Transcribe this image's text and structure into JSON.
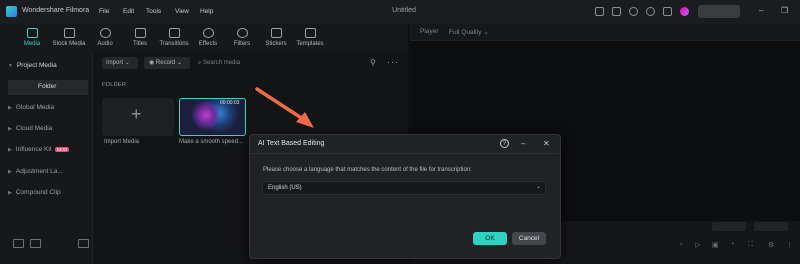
{
  "app": {
    "name": "Wondershare Filmora",
    "document_title": "Untitled"
  },
  "menu": [
    "File",
    "Edit",
    "Tools",
    "View",
    "Help"
  ],
  "media_tools": [
    {
      "label": "Media",
      "active": true
    },
    {
      "label": "Stock Media"
    },
    {
      "label": "Audio"
    },
    {
      "label": "Titles"
    },
    {
      "label": "Transitions"
    },
    {
      "label": "Effects"
    },
    {
      "label": "Filters"
    },
    {
      "label": "Stickers"
    },
    {
      "label": "Templates"
    }
  ],
  "sidebar": {
    "project_media": "Project Media",
    "folder": "Folder",
    "items": [
      "Global Media",
      "Cloud Media",
      "Influence Kit",
      "Adjustment La...",
      "Compound Clip"
    ],
    "new_badge": "NEW"
  },
  "media_panel": {
    "import_label": "Import",
    "record_label": "Record",
    "search_placeholder": "Search media",
    "folder_header": "FOLDER",
    "import_tile_caption": "Import Media",
    "clip_caption": "Make a smooth speed...",
    "clip_duration": "00:00:03"
  },
  "preview": {
    "player_label": "Player",
    "quality_label": "Full Quality"
  },
  "dialog": {
    "title": "AI Text Based Editing",
    "prompt": "Please choose a language that matches the content of the file for transcription:",
    "language": "English (US)",
    "ok": "OK",
    "cancel": "Cancel"
  },
  "colors": {
    "accent": "#2fd3c2",
    "arrow": "#ef6a4a"
  }
}
